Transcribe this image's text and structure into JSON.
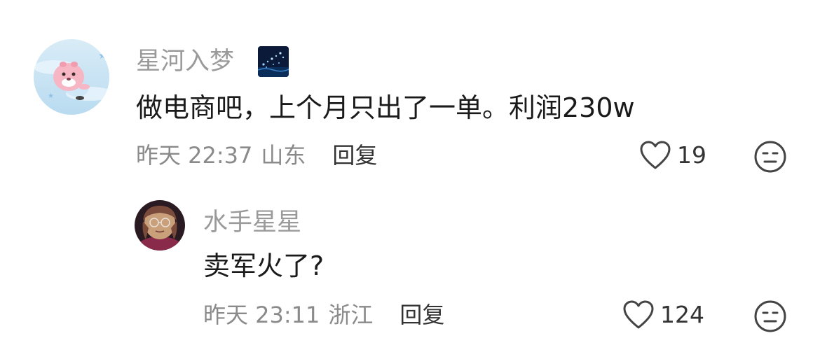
{
  "comments": [
    {
      "username": "星河入梦",
      "content": "做电商吧，上个月只出了一单。利润230w",
      "time": "昨天 22:37",
      "location": "山东",
      "reply_label": "回复",
      "likes": "19",
      "avatar": "pink-beaver-cartoon-avatar",
      "badge": "starry-sky-badge"
    },
    {
      "username": "水手星星",
      "content": "卖军火了?",
      "time": "昨天 23:11",
      "location": "浙江",
      "reply_label": "回复",
      "likes": "124",
      "avatar": "pink-hair-glasses-avatar"
    }
  ],
  "colors": {
    "username": "#9a9a9a",
    "content": "#1a1a1a",
    "meta": "#8a8a8a",
    "reply": "#333333",
    "icon": "#444444"
  }
}
